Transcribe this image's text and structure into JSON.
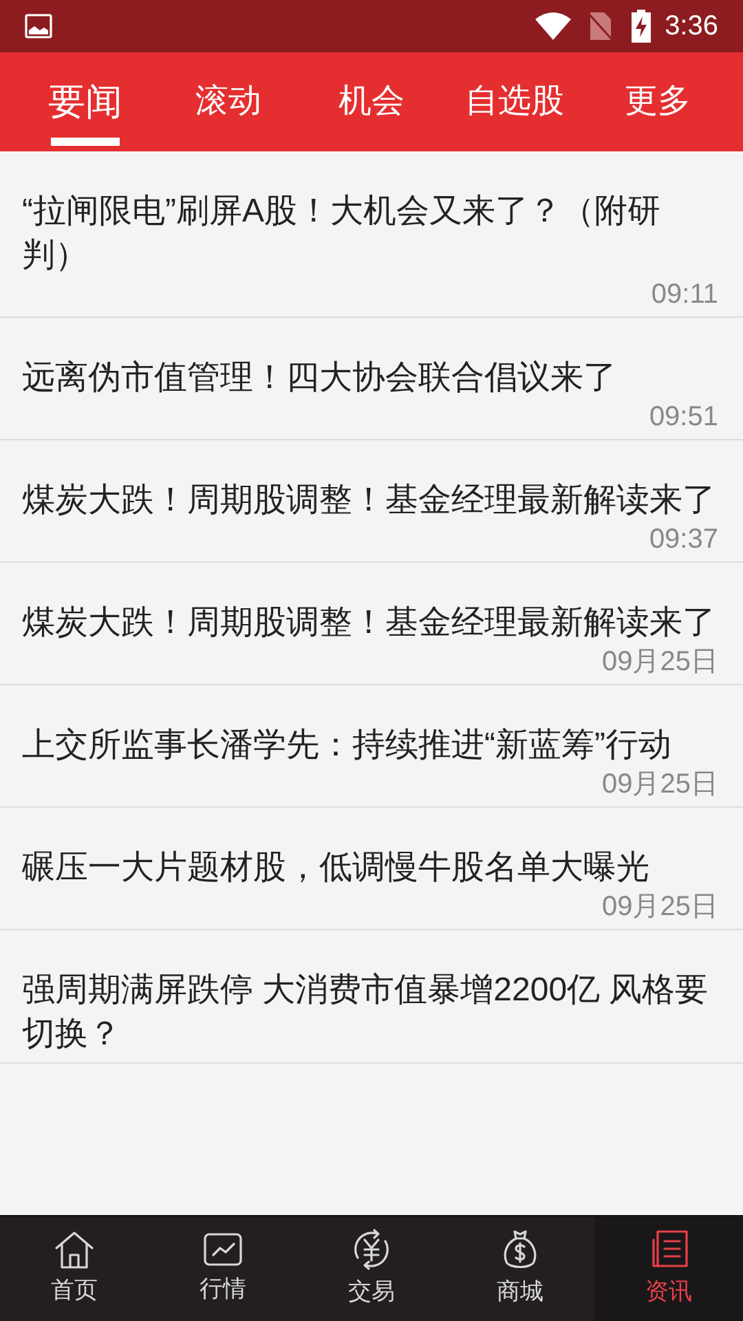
{
  "status_bar": {
    "time": "3:36"
  },
  "tabs": [
    {
      "label": "要闻",
      "selected": true
    },
    {
      "label": "滚动",
      "selected": false
    },
    {
      "label": "机会",
      "selected": false
    },
    {
      "label": "自选股",
      "selected": false
    },
    {
      "label": "更多",
      "selected": false
    }
  ],
  "news": [
    {
      "title": "“拉闸限电”刷屏A股！大机会又来了？（附研判）",
      "time": "09:11"
    },
    {
      "title": "远离伪市值管理！四大协会联合倡议来了",
      "time": "09:51"
    },
    {
      "title": "煤炭大跌！周期股调整！基金经理最新解读来了",
      "time": "09:37"
    },
    {
      "title": "煤炭大跌！周期股调整！基金经理最新解读来了",
      "time": "09月25日"
    },
    {
      "title": "上交所监事长潘学先：持续推进“新蓝筹”行动",
      "time": "09月25日"
    },
    {
      "title": "碾压一大片题材股，低调慢牛股名单大曝光",
      "time": "09月25日"
    },
    {
      "title": "强周期满屏跌停  大消费市值暴增2200亿 风格要切换？"
    }
  ],
  "bottom_nav": [
    {
      "kind": "home",
      "label": "首页",
      "selected": false
    },
    {
      "kind": "chart",
      "label": "行情",
      "selected": false
    },
    {
      "kind": "trade",
      "label": "交易",
      "selected": false
    },
    {
      "kind": "mall",
      "label": "商城",
      "selected": false
    },
    {
      "kind": "news",
      "label": "资讯",
      "selected": true
    }
  ]
}
